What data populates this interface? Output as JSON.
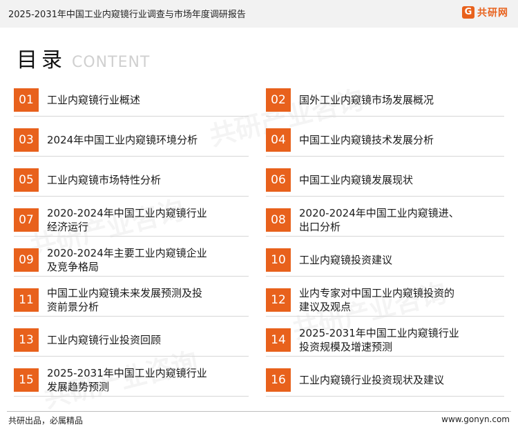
{
  "header": {
    "report_title": "2025-2031年中国工业内窥镜行业调查与市场年度调研报告",
    "logo_text": "共研网",
    "logo_mark": "G"
  },
  "toc": {
    "title": "目录",
    "subtitle": "CONTENT",
    "items": [
      {
        "num": "01",
        "lines": [
          "工业内窥镜行业概述"
        ]
      },
      {
        "num": "02",
        "lines": [
          "国外工业内窥镜市场发展概况"
        ]
      },
      {
        "num": "03",
        "lines": [
          "2024年中国工业内窥镜环境分析"
        ]
      },
      {
        "num": "04",
        "lines": [
          "中国工业内窥镜技术发展分析"
        ]
      },
      {
        "num": "05",
        "lines": [
          "工业内窥镜市场特性分析"
        ]
      },
      {
        "num": "06",
        "lines": [
          "中国工业内窥镜发展现状"
        ]
      },
      {
        "num": "07",
        "lines": [
          "2020-2024年中国工业内窥镜行业",
          "经济运行"
        ]
      },
      {
        "num": "08",
        "lines": [
          "2020-2024年中国工业内窥镜进、",
          "出口分析"
        ]
      },
      {
        "num": "09",
        "lines": [
          "2020-2024年主要工业内窥镜企业",
          "及竞争格局"
        ]
      },
      {
        "num": "10",
        "lines": [
          "工业内窥镜投资建议"
        ]
      },
      {
        "num": "11",
        "lines": [
          "中国工业内窥镜未来发展预测及投",
          "资前景分析"
        ]
      },
      {
        "num": "12",
        "lines": [
          "业内专家对中国工业内窥镜投资的",
          "建议及观点"
        ]
      },
      {
        "num": "13",
        "lines": [
          "工业内窥镜行业投资回顾"
        ]
      },
      {
        "num": "14",
        "lines": [
          "2025-2031年中国工业内窥镜行业",
          "投资规模及增速预测"
        ]
      },
      {
        "num": "15",
        "lines": [
          "2025-2031年中国工业内窥镜行业",
          "发展趋势预测"
        ]
      },
      {
        "num": "16",
        "lines": [
          "工业内窥镜行业投资现状及建议"
        ]
      }
    ]
  },
  "footer": {
    "slogan": "共研出品，必属精品",
    "site": "www.gonyn.com"
  },
  "colors": {
    "accent": "#e8611c",
    "header_bg": "#f2f2f2",
    "divider": "#d6d6d6"
  }
}
